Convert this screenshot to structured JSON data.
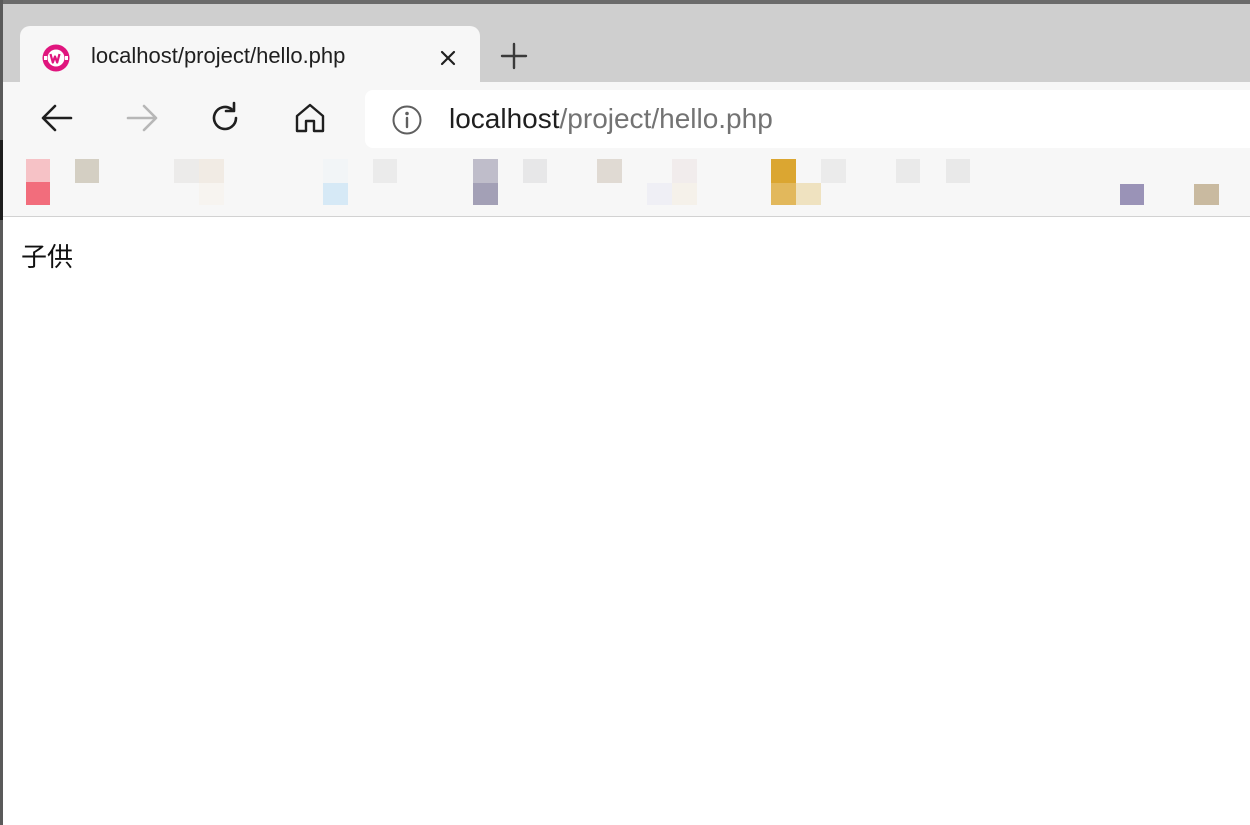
{
  "browser": {
    "tab": {
      "title": "localhost/project/hello.php",
      "favicon": "wampserver-icon"
    },
    "icons": {
      "close": "close-icon",
      "new_tab": "plus-icon",
      "back": "arrow-left-icon",
      "forward": "arrow-right-icon",
      "reload": "reload-icon",
      "home": "home-icon",
      "site_info": "info-icon"
    },
    "address": {
      "host": "localhost",
      "path": "/project/hello.php"
    },
    "colors": {
      "accent": "#e0157e",
      "tabstrip": "#cfcfcf",
      "toolbar": "#f7f7f7"
    }
  },
  "page": {
    "text": "子供"
  }
}
